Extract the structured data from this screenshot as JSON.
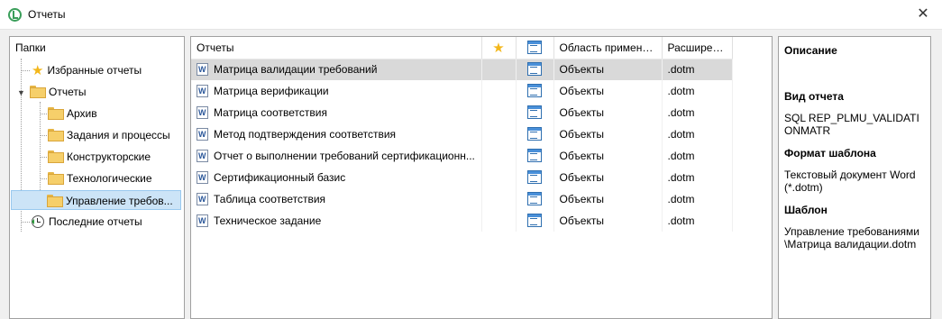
{
  "window": {
    "title": "Отчеты",
    "close_glyph": "✕"
  },
  "folders": {
    "header": "Папки",
    "items": [
      {
        "label": "Избранные отчеты"
      },
      {
        "label": "Отчеты"
      },
      {
        "label": "Архив"
      },
      {
        "label": "Задания и процессы"
      },
      {
        "label": "Конструкторские"
      },
      {
        "label": "Технологические"
      },
      {
        "label": "Управление требов..."
      },
      {
        "label": "Последние отчеты"
      }
    ]
  },
  "reports": {
    "columns": {
      "name": "Отчеты",
      "area": "Область примене...",
      "ext": "Расширен..."
    },
    "rows": [
      {
        "name": "Матрица валидации требований",
        "area": "Объекты",
        "ext": ".dotm"
      },
      {
        "name": "Матрица верификации",
        "area": "Объекты",
        "ext": ".dotm"
      },
      {
        "name": "Матрица соответствия",
        "area": "Объекты",
        "ext": ".dotm"
      },
      {
        "name": "Метод подтверждения соответствия",
        "area": "Объекты",
        "ext": ".dotm"
      },
      {
        "name": "Отчет о выполнении требований сертификационн...",
        "area": "Объекты",
        "ext": ".dotm"
      },
      {
        "name": "Сертификационный базис",
        "area": "Объекты",
        "ext": ".dotm"
      },
      {
        "name": "Таблица соответствия",
        "area": "Объекты",
        "ext": ".dotm"
      },
      {
        "name": "Техническое задание",
        "area": "Объекты",
        "ext": ".dotm"
      }
    ]
  },
  "description": {
    "header": "Описание",
    "type_label": "Вид отчета",
    "type_value": "SQL REP_PLMU_VALIDATIONMATR",
    "format_label": "Формат шаблона",
    "format_value": "Текстовый документ Word (*.dotm)",
    "template_label": "Шаблон",
    "template_value": "Управление требованиями\\Матрица валидации.dotm"
  },
  "icons": {
    "app": "app-logo-icon",
    "favorite": "star-icon",
    "folder": "folder-icon",
    "recent": "recent-clock-icon",
    "report": "word-document-icon",
    "report_type": "report-type-icon"
  },
  "colors": {
    "tree_selection": "#cce4f7",
    "row_selection": "#d9d9d9",
    "star": "#f3b71b"
  }
}
